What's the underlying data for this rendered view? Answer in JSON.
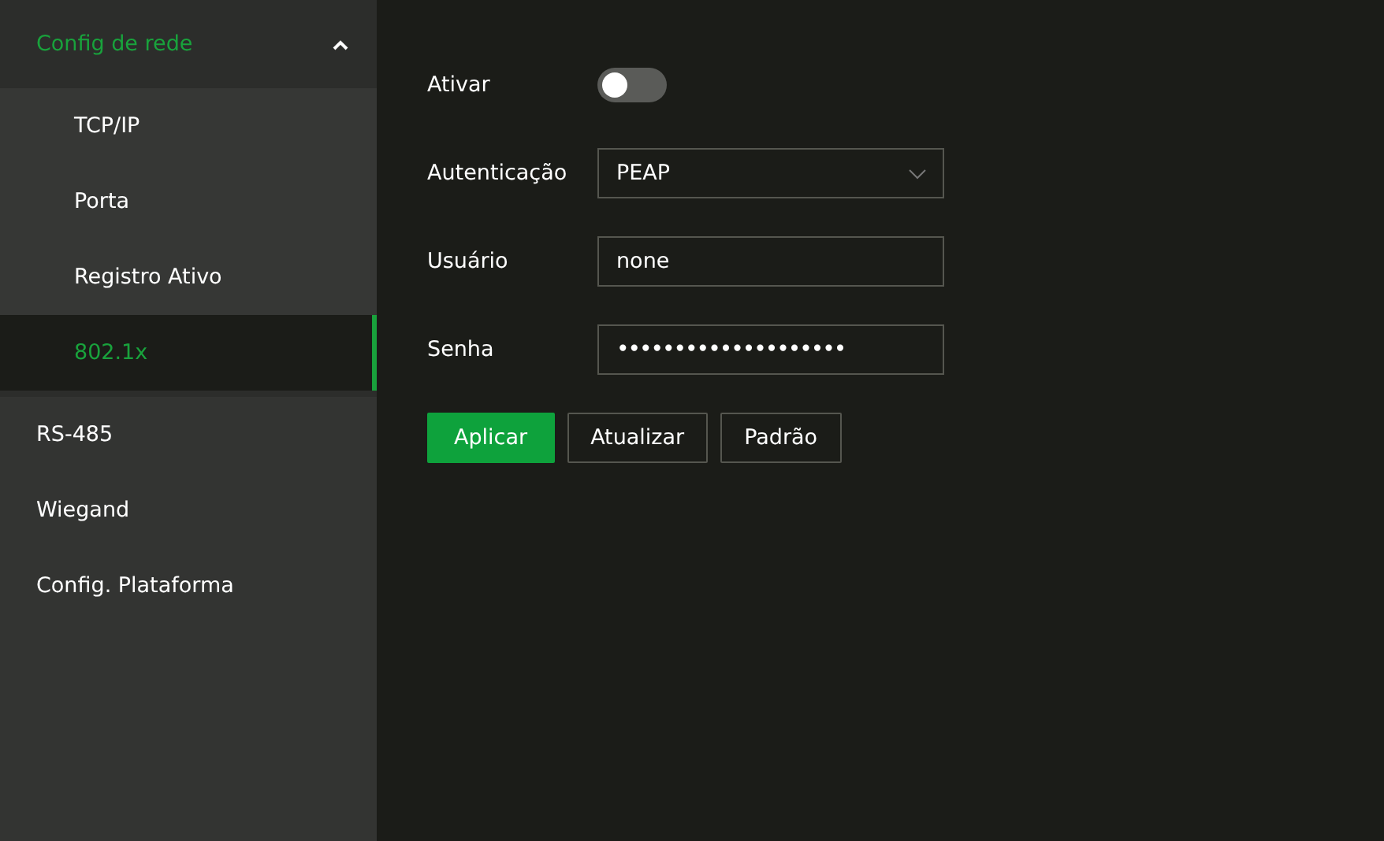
{
  "sidebar": {
    "items": [
      {
        "label": "Config de rede",
        "expanded": true,
        "selected": false,
        "children": [
          {
            "label": "TCP/IP",
            "selected": false
          },
          {
            "label": "Porta",
            "selected": false
          },
          {
            "label": "Registro Ativo",
            "selected": false
          },
          {
            "label": "802.1x",
            "selected": true
          }
        ]
      },
      {
        "label": "RS-485",
        "selected": false
      },
      {
        "label": "Wiegand",
        "selected": false
      },
      {
        "label": "Config. Plataforma",
        "selected": false
      }
    ]
  },
  "form": {
    "fields": [
      {
        "kind": "toggle",
        "label": "Ativar",
        "on": false
      },
      {
        "kind": "select",
        "label": "Autenticação",
        "value": "PEAP"
      },
      {
        "kind": "text",
        "label": "Usuário",
        "value": "none"
      },
      {
        "kind": "password",
        "label": "Senha",
        "value": "••••••••••••••••••••"
      }
    ],
    "buttons": [
      {
        "label": "Aplicar",
        "primary": true
      },
      {
        "label": "Atualizar",
        "primary": false
      },
      {
        "label": "Padrão",
        "primary": false
      }
    ]
  }
}
